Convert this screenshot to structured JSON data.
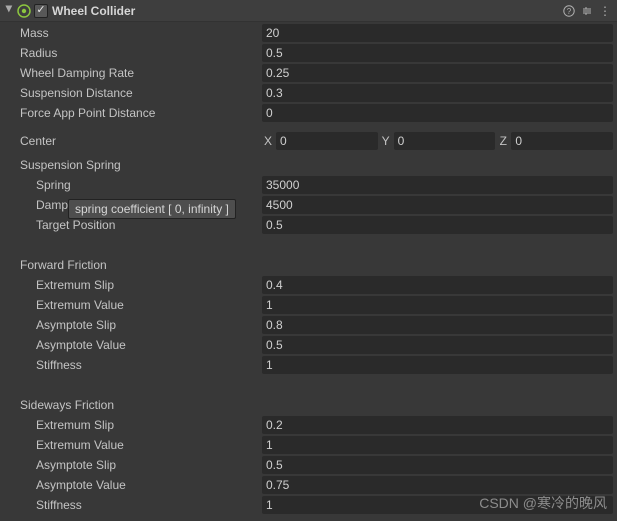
{
  "header": {
    "title": "Wheel Collider",
    "enabled_check": "✓"
  },
  "fields": {
    "mass": {
      "label": "Mass",
      "value": "20"
    },
    "radius": {
      "label": "Radius",
      "value": "0.5"
    },
    "damping": {
      "label": "Wheel Damping Rate",
      "value": "0.25"
    },
    "suspDist": {
      "label": "Suspension Distance",
      "value": "0.3"
    },
    "forceApp": {
      "label": "Force App Point Distance",
      "value": "0"
    }
  },
  "center": {
    "label": "Center",
    "x": "0",
    "y": "0",
    "z": "0",
    "X": "X",
    "Y": "Y",
    "Z": "Z"
  },
  "spring": {
    "header": "Suspension Spring",
    "spring": {
      "label": "Spring",
      "value": "35000"
    },
    "damper": {
      "label": "Damper",
      "value": "4500"
    },
    "target": {
      "label": "Target Position",
      "value": "0.5"
    }
  },
  "forward": {
    "header": "Forward Friction",
    "extSlip": {
      "label": "Extremum Slip",
      "value": "0.4"
    },
    "extVal": {
      "label": "Extremum Value",
      "value": "1"
    },
    "asySlip": {
      "label": "Asymptote Slip",
      "value": "0.8"
    },
    "asyVal": {
      "label": "Asymptote Value",
      "value": "0.5"
    },
    "stiff": {
      "label": "Stiffness",
      "value": "1"
    }
  },
  "sideways": {
    "header": "Sideways Friction",
    "extSlip": {
      "label": "Extremum Slip",
      "value": "0.2"
    },
    "extVal": {
      "label": "Extremum Value",
      "value": "1"
    },
    "asySlip": {
      "label": "Asymptote Slip",
      "value": "0.5"
    },
    "asyVal": {
      "label": "Asymptote Value",
      "value": "0.75"
    },
    "stiff": {
      "label": "Stiffness",
      "value": "1"
    }
  },
  "tooltip": "spring coefficient [ 0, infinity  ]",
  "watermark": "CSDN @寒冷的晚风"
}
